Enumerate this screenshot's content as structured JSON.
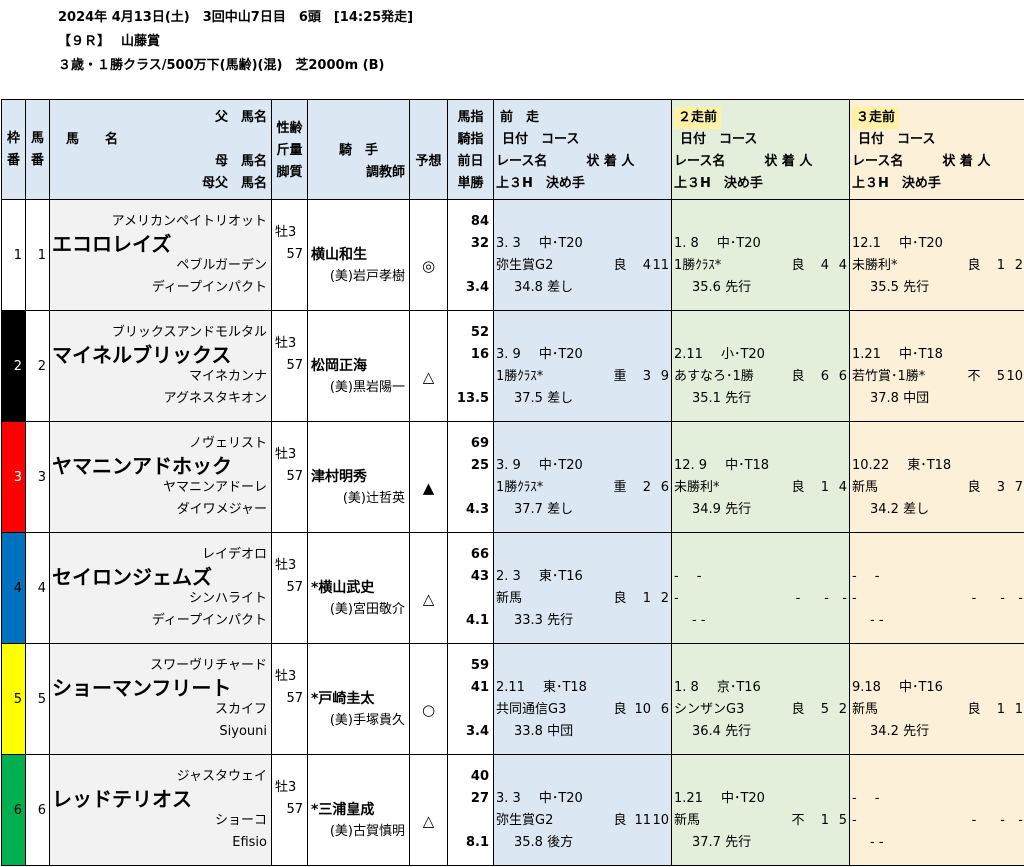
{
  "header": {
    "line1": "2024年 4月13日(土)　3回中山7日目　6頭　[14:25発走]",
    "line2": "【９Ｒ】　 山藤賞",
    "line3": "３歳・１勝クラス/500万下(馬齢)(混)　芝2000m (B)"
  },
  "colors": {
    "waku": [
      "#ffffff",
      "#000000",
      "#ff0000",
      "#0070c0",
      "#ffff00",
      "#00b050"
    ],
    "waku_text": [
      "#000",
      "#fff",
      "#fff",
      "#000",
      "#000",
      "#000"
    ],
    "prev1": "#dbe7f3",
    "prev2": "#e3efda",
    "prev3": "#fdf0d8",
    "header": "#dbe7f3"
  },
  "cols": {
    "waku": [
      "枠",
      "番"
    ],
    "uma": [
      "馬",
      "番"
    ],
    "sire": "父　馬名",
    "horse": "馬　　名",
    "dam": "母　馬名",
    "damsire": "母父　馬名",
    "sex": "性齢",
    "weight": "斤量",
    "style": "脚質",
    "jockey": "騎　手",
    "trainer": "調教師",
    "yoso": "予想",
    "idx": [
      "馬指",
      "騎指",
      "前日",
      "単勝"
    ],
    "prev1_title": "前　走",
    "prev2_title": "２走前",
    "prev3_title": "３走前",
    "prev_date": "日付　コース",
    "prev_race": "レース名　　　状 着 人",
    "prev_last": "上３H　決め手"
  },
  "horses": [
    {
      "waku": "1",
      "num": "1",
      "sire": "アメリカンペイトリオット",
      "name": "エコロレイズ",
      "dam": "ペブルガーデン",
      "damsire": "ディープインパクト",
      "sex": "牡3",
      "weight": "57",
      "style": "",
      "jockey": "横山和生",
      "trainer": "(美)岩戸孝樹",
      "mark": "◎",
      "uma_idx": "84",
      "jockey_idx": "32",
      "odds": "3.4",
      "p1": {
        "date": "3. 3",
        "course": "中･T20",
        "race": "弥生賞G2",
        "cond": "良",
        "fin": "4",
        "pop": "11",
        "last3": "34.8",
        "style": "差し"
      },
      "p2": {
        "date": "1. 8",
        "course": "中･T20",
        "race": "1勝ｸﾗｽ*",
        "cond": "良",
        "fin": "4",
        "pop": "4",
        "last3": "35.6",
        "style": "先行"
      },
      "p3": {
        "date": "12.1",
        "course": "中･T20",
        "race": "未勝利*",
        "cond": "良",
        "fin": "1",
        "pop": "2",
        "last3": "35.5",
        "style": "先行"
      }
    },
    {
      "waku": "2",
      "num": "2",
      "sire": "ブリックスアンドモルタル",
      "name": "マイネルブリックス",
      "dam": "マイネカンナ",
      "damsire": "アグネスタキオン",
      "sex": "牡3",
      "weight": "57",
      "style": "",
      "jockey": "松岡正海",
      "trainer": "(美)黒岩陽一",
      "mark": "△",
      "uma_idx": "52",
      "jockey_idx": "16",
      "odds": "13.5",
      "p1": {
        "date": "3. 9",
        "course": "中･T20",
        "race": "1勝ｸﾗｽ*",
        "cond": "重",
        "fin": "3",
        "pop": "9",
        "last3": "37.5",
        "style": "差し"
      },
      "p2": {
        "date": "2.11",
        "course": "小･T20",
        "race": "あすなろ･1勝",
        "cond": "良",
        "fin": "6",
        "pop": "6",
        "last3": "35.1",
        "style": "先行"
      },
      "p3": {
        "date": "1.21",
        "course": "中･T18",
        "race": "若竹賞･1勝*",
        "cond": "不",
        "fin": "5",
        "pop": "10",
        "last3": "37.8",
        "style": "中団"
      }
    },
    {
      "waku": "3",
      "num": "3",
      "sire": "ノヴェリスト",
      "name": "ヤマニンアドホック",
      "dam": "ヤマニンアドーレ",
      "damsire": "ダイワメジャー",
      "sex": "牡3",
      "weight": "57",
      "style": "",
      "jockey": "津村明秀",
      "trainer": "(美)辻哲英",
      "mark": "▲",
      "uma_idx": "69",
      "jockey_idx": "25",
      "odds": "4.3",
      "p1": {
        "date": "3. 9",
        "course": "中･T20",
        "race": "1勝ｸﾗｽ*",
        "cond": "重",
        "fin": "2",
        "pop": "6",
        "last3": "37.7",
        "style": "差し"
      },
      "p2": {
        "date": "12. 9",
        "course": "中･T18",
        "race": "未勝利*",
        "cond": "良",
        "fin": "1",
        "pop": "4",
        "last3": "34.9",
        "style": "先行"
      },
      "p3": {
        "date": "10.22",
        "course": "東･T18",
        "race": "新馬",
        "cond": "良",
        "fin": "3",
        "pop": "7",
        "last3": "34.2",
        "style": "差し"
      }
    },
    {
      "waku": "4",
      "num": "4",
      "sire": "レイデオロ",
      "name": "セイロンジェムズ",
      "dam": "シンハライト",
      "damsire": "ディープインパクト",
      "sex": "牡3",
      "weight": "57",
      "style": "",
      "jockey": "*横山武史",
      "trainer": "(美)宮田敬介",
      "mark": "△",
      "uma_idx": "66",
      "jockey_idx": "43",
      "odds": "4.1",
      "p1": {
        "date": "2. 3",
        "course": "東･T16",
        "race": "新馬",
        "cond": "良",
        "fin": "1",
        "pop": "2",
        "last3": "33.3",
        "style": "先行"
      },
      "p2": {
        "date": "-",
        "course": "-",
        "race": "-",
        "cond": "-",
        "fin": "-",
        "pop": "-",
        "last3": "-",
        "style": "-"
      },
      "p3": {
        "date": "-",
        "course": "-",
        "race": "-",
        "cond": "-",
        "fin": "-",
        "pop": "-",
        "last3": "-",
        "style": "-"
      }
    },
    {
      "waku": "5",
      "num": "5",
      "sire": "スワーヴリチャード",
      "name": "ショーマンフリート",
      "dam": "スカイフ",
      "damsire": "Siyouni",
      "sex": "牡3",
      "weight": "57",
      "style": "",
      "jockey": "*戸崎圭太",
      "trainer": "(美)手塚貴久",
      "mark": "○",
      "uma_idx": "59",
      "jockey_idx": "41",
      "odds": "3.4",
      "p1": {
        "date": "2.11",
        "course": "東･T18",
        "race": "共同通信G3",
        "cond": "良",
        "fin": "10",
        "pop": "6",
        "last3": "33.8",
        "style": "中団"
      },
      "p2": {
        "date": "1. 8",
        "course": "京･T16",
        "race": "シンザンG3",
        "cond": "良",
        "fin": "5",
        "pop": "2",
        "last3": "36.4",
        "style": "先行"
      },
      "p3": {
        "date": "9.18",
        "course": "中･T16",
        "race": "新馬",
        "cond": "良",
        "fin": "1",
        "pop": "1",
        "last3": "34.2",
        "style": "先行"
      }
    },
    {
      "waku": "6",
      "num": "6",
      "sire": "ジャスタウェイ",
      "name": "レッドテリオス",
      "dam": "ショーコ",
      "damsire": "Efisio",
      "sex": "牡3",
      "weight": "57",
      "style": "",
      "jockey": "*三浦皇成",
      "trainer": "(美)古賀慎明",
      "mark": "△",
      "uma_idx": "40",
      "jockey_idx": "27",
      "odds": "8.1",
      "p1": {
        "date": "3. 3",
        "course": "中･T20",
        "race": "弥生賞G2",
        "cond": "良",
        "fin": "11",
        "pop": "10",
        "last3": "35.8",
        "style": "後方"
      },
      "p2": {
        "date": "1.21",
        "course": "中･T20",
        "race": "新馬",
        "cond": "不",
        "fin": "1",
        "pop": "5",
        "last3": "37.7",
        "style": "先行"
      },
      "p3": {
        "date": "-",
        "course": "-",
        "race": "-",
        "cond": "-",
        "fin": "-",
        "pop": "-",
        "last3": "-",
        "style": "-"
      }
    }
  ]
}
